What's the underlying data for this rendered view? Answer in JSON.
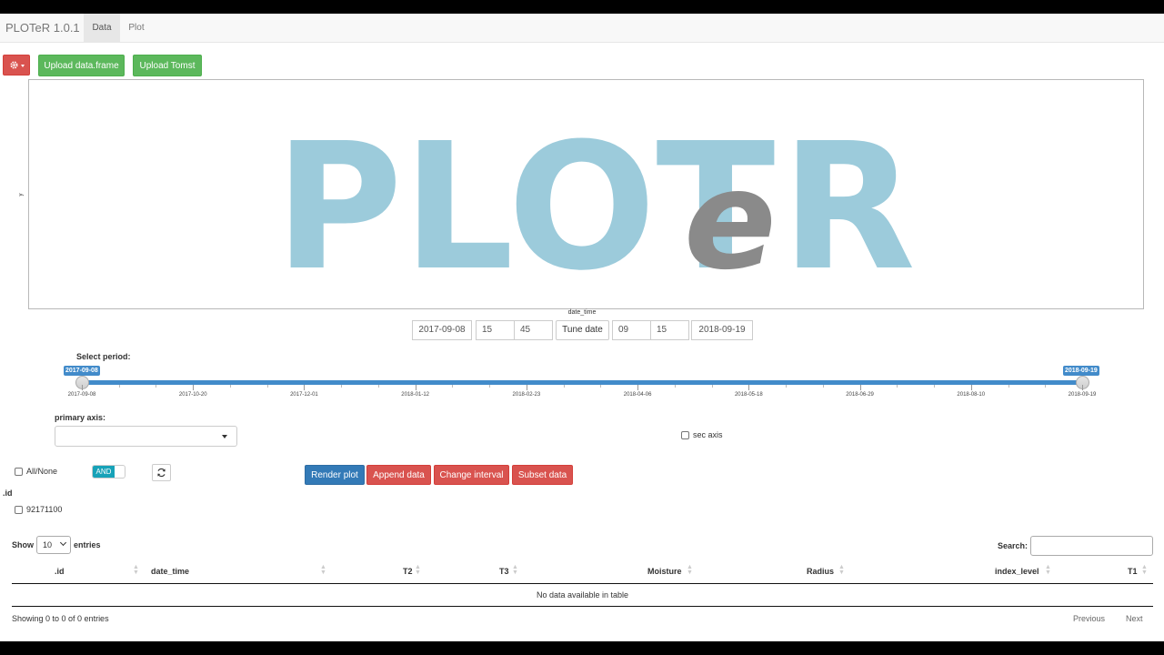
{
  "navbar": {
    "brand": "PLOTeR 1.0.1",
    "tabs": [
      {
        "label": "Data",
        "active": true
      },
      {
        "label": "Plot",
        "active": false
      }
    ]
  },
  "toolbar": {
    "gear_icon": "gear-icon",
    "upload_df_label": "Upload data.frame",
    "upload_tomst_label": "Upload Tomst"
  },
  "plot": {
    "logo": {
      "part1": "PLOT",
      "part2": "e",
      "part3": "R",
      "color_main": "#9ccbdb",
      "color_e": "#8a8a8a"
    },
    "ylabel": "y",
    "xlabel": "date_time"
  },
  "date_controls": {
    "start_date": "2017-09-08",
    "start_hour": "15",
    "start_minute": "45",
    "tune_label": "Tune date",
    "end_hour": "09",
    "end_minute": "15",
    "end_date": "2018-09-19"
  },
  "period": {
    "label": "Select period:",
    "from": "2017-09-08",
    "to": "2018-09-19",
    "ticks": [
      "2017-09-08",
      "2017-10-20",
      "2017-12-01",
      "2018-01-12",
      "2018-02-23",
      "2018-04-06",
      "2018-05-18",
      "2018-06-29",
      "2018-08-10",
      "2018-09-19"
    ]
  },
  "primary_axis": {
    "label": "primary axis:",
    "value": ""
  },
  "sec_axis": {
    "label": "sec axis",
    "checked": false
  },
  "filters": {
    "all_none_label": "All/None",
    "toggle_label": "AND",
    "id_header": ".id",
    "ids": [
      "92171100"
    ]
  },
  "actions": {
    "render": "Render plot",
    "append": "Append data",
    "change_interval": "Change interval",
    "subset": "Subset data"
  },
  "table": {
    "show_label": "Show",
    "entries_label": "entries",
    "page_length": "10",
    "search_label": "Search:",
    "columns": [
      ".id",
      "date_time",
      "T2",
      "T3",
      "Moisture",
      "Radius",
      "index_level",
      "T1"
    ],
    "empty_text": "No data available in table",
    "info": "Showing 0 to 0 of 0 entries",
    "prev_label": "Previous",
    "next_label": "Next"
  },
  "colors": {
    "green": "#5cb85c",
    "red": "#d9534f",
    "blue": "#337ab7",
    "teal": "#17a2b8",
    "slider": "#428bca"
  }
}
